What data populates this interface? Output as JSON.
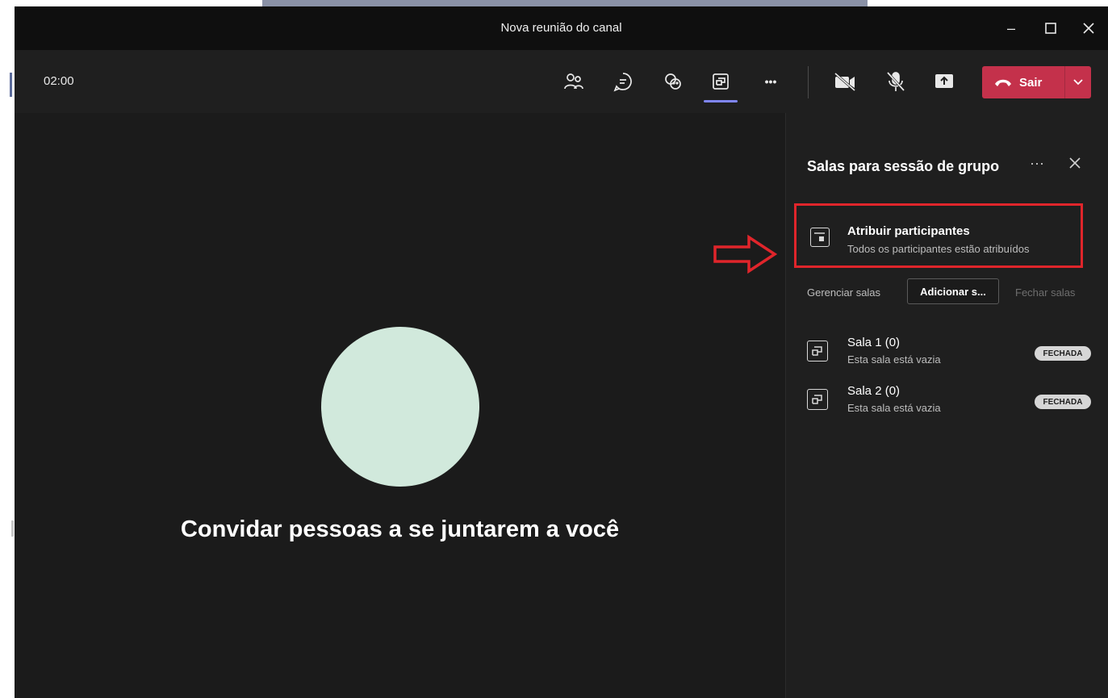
{
  "window": {
    "title": "Nova reunião do canal",
    "minimize": "–",
    "maximize": "☐",
    "close": "✕"
  },
  "toolbar": {
    "timer": "02:00",
    "icons": [
      "people-icon",
      "chat-icon",
      "reactions-icon",
      "breakout-rooms-icon",
      "more-icon",
      "camera-off-icon",
      "mic-off-icon",
      "share-icon"
    ],
    "more_label": "•••",
    "leave_label": "Sair"
  },
  "stage": {
    "invite_text": "Convidar pessoas a se juntarem a você"
  },
  "panel": {
    "title": "Salas para sessão de grupo",
    "more_label": "···",
    "close_label": "✕",
    "assign": {
      "title": "Atribuir participantes",
      "subtitle": "Todos os participantes estão atribuídos"
    },
    "manage_label": "Gerenciar salas",
    "add_label": "Adicionar s...",
    "close_rooms_label": "Fechar salas",
    "rooms": [
      {
        "name": "Sala 1 (0)",
        "status": "Esta sala está vazia",
        "badge": "FECHADA"
      },
      {
        "name": "Sala 2 (0)",
        "status": "Esta sala está vazia",
        "badge": "FECHADA"
      }
    ]
  },
  "colors": {
    "accent": "#7f85f5",
    "leave": "#c4314b",
    "highlight": "#e0252b",
    "avatar": "#d1e9dc"
  }
}
